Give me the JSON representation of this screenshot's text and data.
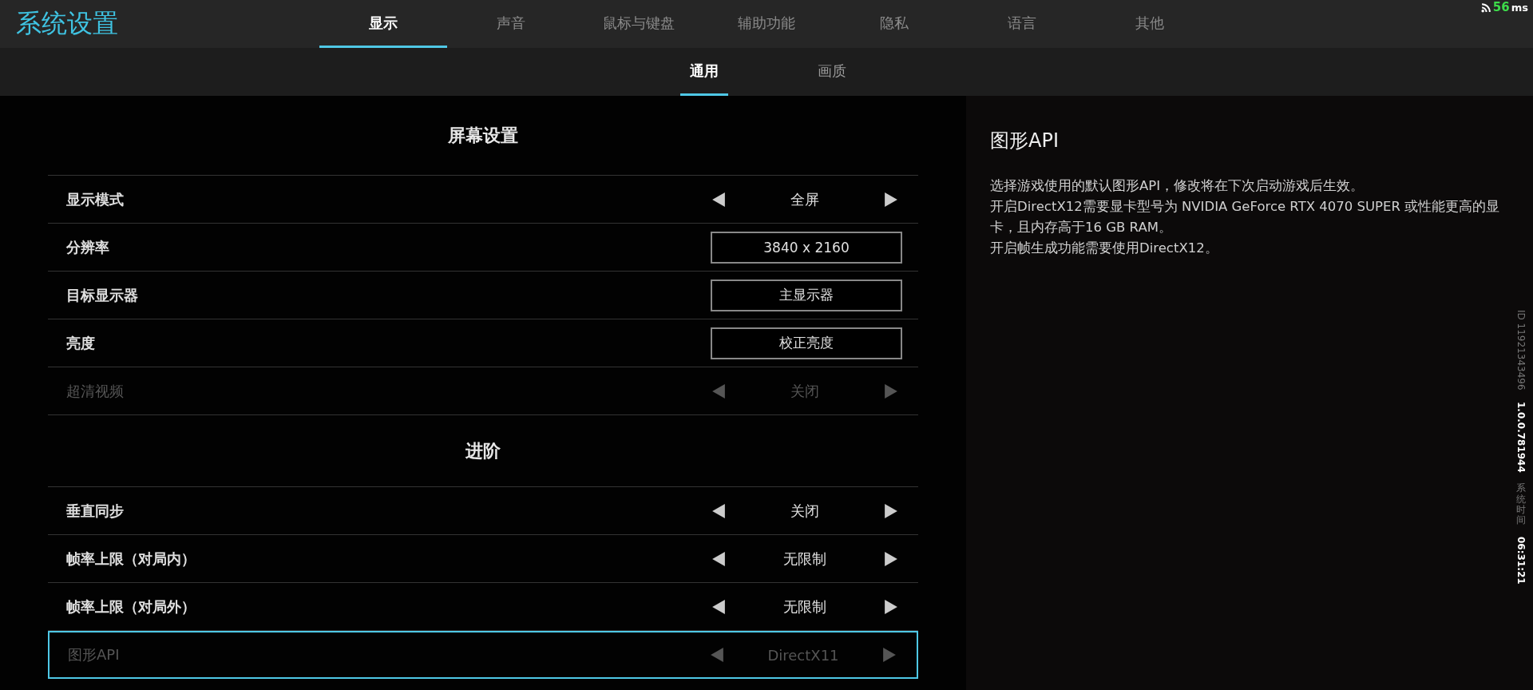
{
  "header": {
    "title": "系统设置",
    "tabs": [
      {
        "label": "显示",
        "selected": true
      },
      {
        "label": "声音",
        "selected": false
      },
      {
        "label": "鼠标与键盘",
        "selected": false
      },
      {
        "label": "辅助功能",
        "selected": false
      },
      {
        "label": "隐私",
        "selected": false
      },
      {
        "label": "语言",
        "selected": false
      },
      {
        "label": "其他",
        "selected": false
      }
    ],
    "ping": {
      "value": "56",
      "unit": "ms"
    }
  },
  "subtabs": [
    {
      "label": "通用",
      "selected": true
    },
    {
      "label": "画质",
      "selected": false
    }
  ],
  "sections": [
    {
      "title": "屏幕设置",
      "rows": [
        {
          "kind": "selector",
          "label": "显示模式",
          "value": "全屏",
          "disabled": false,
          "selected": false
        },
        {
          "kind": "button",
          "label": "分辨率",
          "value": "3840 x 2160",
          "disabled": false,
          "selected": false
        },
        {
          "kind": "button",
          "label": "目标显示器",
          "value": "主显示器",
          "disabled": false,
          "selected": false
        },
        {
          "kind": "button",
          "label": "亮度",
          "value": "校正亮度",
          "disabled": false,
          "selected": false
        },
        {
          "kind": "selector",
          "label": "超清视频",
          "value": "关闭",
          "disabled": true,
          "selected": false
        }
      ]
    },
    {
      "title": "进阶",
      "rows": [
        {
          "kind": "selector",
          "label": "垂直同步",
          "value": "关闭",
          "disabled": false,
          "selected": false
        },
        {
          "kind": "selector",
          "label": "帧率上限（对局内）",
          "value": "无限制",
          "disabled": false,
          "selected": false
        },
        {
          "kind": "selector",
          "label": "帧率上限（对局外）",
          "value": "无限制",
          "disabled": false,
          "selected": false
        },
        {
          "kind": "selector",
          "label": "图形API",
          "value": "DirectX11",
          "disabled": true,
          "selected": true
        }
      ]
    }
  ],
  "detail": {
    "title": "图形API",
    "lines": [
      "选择游戏使用的默认图形API，修改将在下次启动游戏后生效。",
      "开启DirectX12需要显卡型号为 NVIDIA GeForce RTX 4070 SUPER 或性能更高的显卡，且内存高于16 GB RAM。",
      "开启帧生成功能需要使用DirectX12。"
    ]
  },
  "side_info": {
    "id": "ID 11921343496",
    "version": "1.0.0.781944",
    "time_label": "系统时间",
    "time": "06:31:21"
  }
}
